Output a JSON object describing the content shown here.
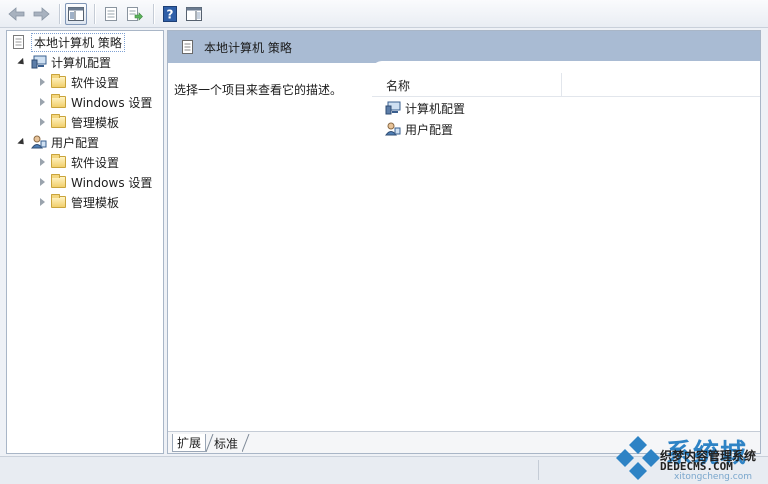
{
  "window": {
    "title": "本地计算机 策略"
  },
  "toolbar": {
    "buttons": [
      "back-arrow-icon",
      "forward-arrow-icon",
      "show-hide-tree-icon",
      "properties-icon",
      "export-list-icon",
      "help-icon",
      "show-hide-action-pane-icon"
    ]
  },
  "tree": {
    "root_label": "本地计算机 策略",
    "computer_config": {
      "label": "计算机配置",
      "children": [
        "软件设置",
        "Windows 设置",
        "管理模板"
      ]
    },
    "user_config": {
      "label": "用户配置",
      "children": [
        "软件设置",
        "Windows 设置",
        "管理模板"
      ]
    }
  },
  "detail": {
    "header_title": "本地计算机 策略",
    "description": "选择一个项目来查看它的描述。",
    "column_name": "名称",
    "items": [
      "计算机配置",
      "用户配置"
    ]
  },
  "tabs": {
    "extended": "扩展",
    "standard": "标准"
  },
  "watermark": {
    "brand": "系统城",
    "subtitle": "织梦内容管理系统",
    "url": "DEDECMS.COM",
    "small": "xitongcheng.com",
    "accent_color": "#2e83c5"
  }
}
